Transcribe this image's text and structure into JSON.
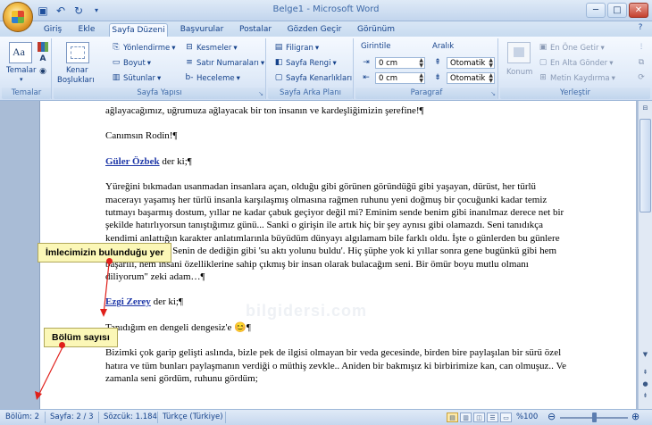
{
  "window": {
    "title": "Belge1 - Microsoft Word",
    "qat": [
      "save",
      "undo",
      "redo"
    ],
    "controls": [
      "minimize",
      "maximize",
      "close"
    ]
  },
  "tabs": [
    "Giriş",
    "Ekle",
    "Sayfa Düzeni",
    "Başvurular",
    "Postalar",
    "Gözden Geçir",
    "Görünüm"
  ],
  "active_tab": "Sayfa Düzeni",
  "ribbon": {
    "temalar": {
      "button": "Temalar",
      "label": "Temalar"
    },
    "sayfa_yapisi": {
      "kenar": "Kenar",
      "bosluklari": "Boşlukları",
      "yonlendirme": "Yönlendirme",
      "boyut": "Boyut",
      "sutunlar": "Sütunlar",
      "kesmeler": "Kesmeler",
      "satir_numaralari": "Satır Numaraları",
      "heceleme": "Heceleme",
      "label": "Sayfa Yapısı"
    },
    "sayfa_arka_plani": {
      "filigran": "Filigran",
      "sayfa_rengi": "Sayfa Rengi",
      "sayfa_kenarliklari": "Sayfa Kenarlıkları",
      "label": "Sayfa Arka Planı"
    },
    "paragraf": {
      "girintile": "Girintile",
      "aralik": "Aralık",
      "girinti_sol": "0 cm",
      "girinti_sag": "0 cm",
      "aralik_once": "Otomatik",
      "aralik_sonra": "Otomatik",
      "label": "Paragraf"
    },
    "yerlestir": {
      "konum": "Konum",
      "en_one_getir": "En Öne Getir",
      "en_alta_gonder": "En Alta Gönder",
      "metin_kaydirma": "Metin Kaydırma",
      "label": "Yerleştir"
    }
  },
  "document": {
    "paragraphs": [
      {
        "parts": [
          {
            "t": "ağlayacağımız, uğrumuza ağlayacak bir ton insanın ve kardeşliğimizin şerefine!¶"
          }
        ]
      },
      {
        "parts": [
          {
            "t": "Canımsın Rodin!¶"
          }
        ]
      },
      {
        "parts": [
          {
            "t": "Güler Özbek",
            "link": true
          },
          {
            "t": " der ki;¶"
          }
        ]
      },
      {
        "parts": [
          {
            "t": "Yüreğini bıkmadan usanmadan insanlara açan, olduğu gibi görünen göründüğü gibi yaşayan, dürüst, her türlü macerayı yaşamış her türlü insanla karşılaşmış olmasına rağmen ruhunu yeni doğmuş bir çocuğunki kadar temiz tutmayı başarmış dostum, yıllar ne kadar çabuk geçiyor değil mi? Eminim sende benim gibi inanılmaz derece net bir şekilde hatırlıyorsun tanıştığımız günü... Sanki o girişin ile artık hiç bir şey aynısı gibi olamazdı. Seni tanıdıkça kendimi anlattığın karakter anlatımlarınla büyüdüm dünyayı algılamam bile farklı oldu. İşte o günlerden bu günlere çok şey yaşandı. Senin de dediğin gibi 'su aktı yolunu buldu'. Hiç şüphe yok ki yıllar sonra gene bugünkü gibi hem başarılı, hem insani özelliklerine sahip çıkmış bir insan olarak bulacağım seni. Bir ömür boyu mutlu olmanı diliyorum\" zeki adam…¶"
          }
        ]
      },
      {
        "parts": [
          {
            "t": "Ezgi Zerey",
            "link": true
          },
          {
            "t": " der ki;¶"
          }
        ]
      },
      {
        "parts": [
          {
            "t": "Tanıdığım en dengeli dengesiz'e 😊¶"
          }
        ]
      },
      {
        "parts": [
          {
            "t": "Bizimki çok garip gelişti aslında, bizle pek de ilgisi olmayan bir veda gecesinde, birden bire paylaşılan bir sürü özel hatıra ve tüm bunları paylaşmanın verdiği o müthiş zevkle.. Aniden bir bakmışız ki birbirimize kan, can olmuşuz.. Ve zamanla seni gördüm, ruhunu gördüm;"
          }
        ]
      }
    ],
    "watermark": "bilgidersi.com"
  },
  "callouts": {
    "cursor": "İmlecimizin bulunduğu yer",
    "section": "Bölüm sayısı"
  },
  "status": {
    "bolum": "Bölüm: 2",
    "sayfa": "Sayfa: 2 / 3",
    "sozcuk": "Sözcük: 1.184",
    "dil": "Türkçe (Türkiye)",
    "zoom": "%100",
    "zoom_level": 0.5
  },
  "colors": {
    "callout_bg": "#fbf7b7",
    "arrow": "#e0201b",
    "link": "#1f38a8"
  }
}
